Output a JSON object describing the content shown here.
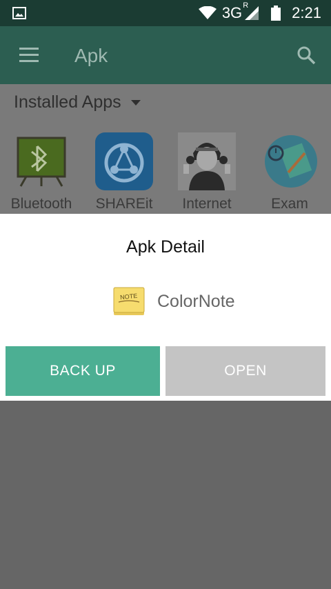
{
  "status_bar": {
    "network": "3G",
    "network_sup": "R",
    "time": "2:21"
  },
  "toolbar": {
    "title": "Apk"
  },
  "filter": {
    "label": "Installed Apps"
  },
  "apps": [
    {
      "label": "Bluetooth"
    },
    {
      "label": "SHAREit"
    },
    {
      "label": "Internet"
    },
    {
      "label": "Exam"
    }
  ],
  "dialog": {
    "title": "Apk Detail",
    "app_name": "ColorNote",
    "app_icon_text": "NOTE",
    "back_up_label": "BACK UP",
    "open_label": "OPEN"
  },
  "colors": {
    "status_bar": "#1b3c33",
    "toolbar": "#2c5e51",
    "back_up_button": "#4caf93",
    "open_button": "#c4c4c4",
    "scrim": "#666666"
  }
}
